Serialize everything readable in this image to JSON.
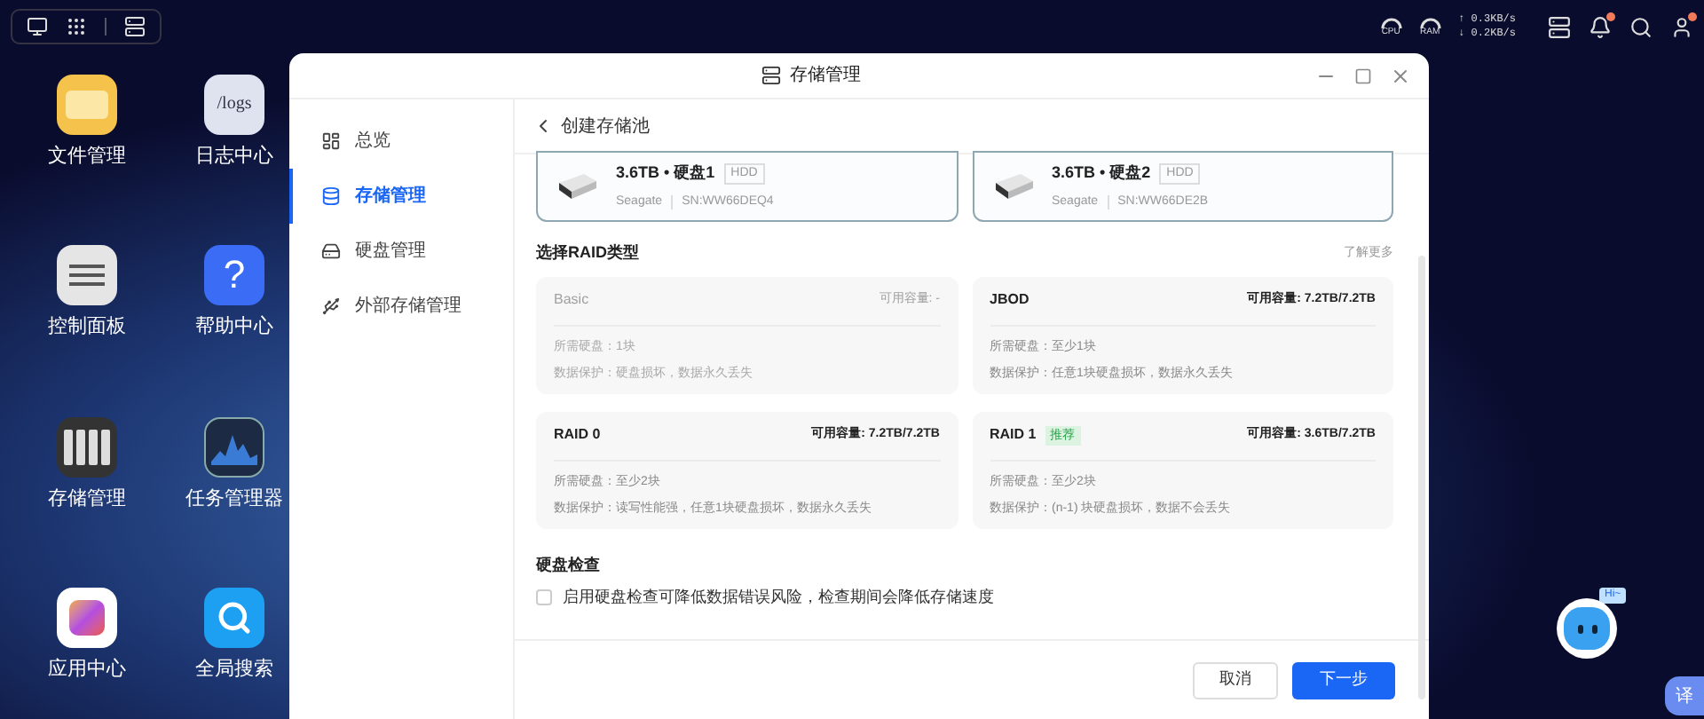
{
  "topbar": {
    "gauges": [
      "CPU",
      "RAM"
    ],
    "net_up": "↑ 0.3KB/s",
    "net_down": "↓ 0.2KB/s"
  },
  "desktop_icons": [
    {
      "label": "文件管理",
      "kind": "folder"
    },
    {
      "label": "控制面板",
      "kind": "control"
    },
    {
      "label": "存储管理",
      "kind": "storage"
    },
    {
      "label": "应用中心",
      "kind": "apps"
    },
    {
      "label": "日志中心",
      "kind": "logs",
      "icon_text": "/logs"
    },
    {
      "label": "帮助中心",
      "kind": "help",
      "icon_text": "?"
    },
    {
      "label": "任务管理器",
      "kind": "task"
    },
    {
      "label": "全局搜索",
      "kind": "search"
    }
  ],
  "window": {
    "title": "存储管理",
    "sidebar": [
      {
        "label": "总览",
        "kind": "overview",
        "selected": false
      },
      {
        "label": "存储管理",
        "kind": "storage",
        "selected": true
      },
      {
        "label": "硬盘管理",
        "kind": "disk",
        "selected": false
      },
      {
        "label": "外部存储管理",
        "kind": "external",
        "selected": false
      }
    ],
    "page_title": "创建存储池",
    "disks": [
      {
        "name": "3.6TB • 硬盘1",
        "type": "HDD",
        "brand": "Seagate",
        "sn": "SN:WW66DEQ4"
      },
      {
        "name": "3.6TB • 硬盘2",
        "type": "HDD",
        "brand": "Seagate",
        "sn": "SN:WW66DE2B"
      }
    ],
    "raid": {
      "title": "选择RAID类型",
      "link": "了解更多",
      "options": [
        {
          "name": "Basic",
          "capacity": "可用容量: -",
          "disks": "所需硬盘：1块",
          "protection": "数据保护：硬盘损坏，数据永久丢失",
          "disabled": true
        },
        {
          "name": "JBOD",
          "capacity": "可用容量: 7.2TB/7.2TB",
          "disks": "所需硬盘：至少1块",
          "protection": "数据保护：任意1块硬盘损坏，数据永久丢失",
          "disabled": false
        },
        {
          "name": "RAID 0",
          "capacity": "可用容量: 7.2TB/7.2TB",
          "disks": "所需硬盘：至少2块",
          "protection": "数据保护：读写性能强，任意1块硬盘损坏，数据永久丢失",
          "disabled": false
        },
        {
          "name": "RAID 1",
          "badge": "推荐",
          "capacity": "可用容量: 3.6TB/7.2TB",
          "disks": "所需硬盘：至少2块",
          "protection": "数据保护：(n-1) 块硬盘损坏，数据不会丢失",
          "disabled": false
        }
      ]
    },
    "disk_check": {
      "title": "硬盘检查",
      "label": "启用硬盘检查可降低数据错误风险，检查期间会降低存储速度",
      "checked": false
    },
    "buttons": {
      "cancel": "取消",
      "next": "下一步"
    }
  },
  "assistant": {
    "bubble": "Hi~",
    "translate": "译"
  }
}
